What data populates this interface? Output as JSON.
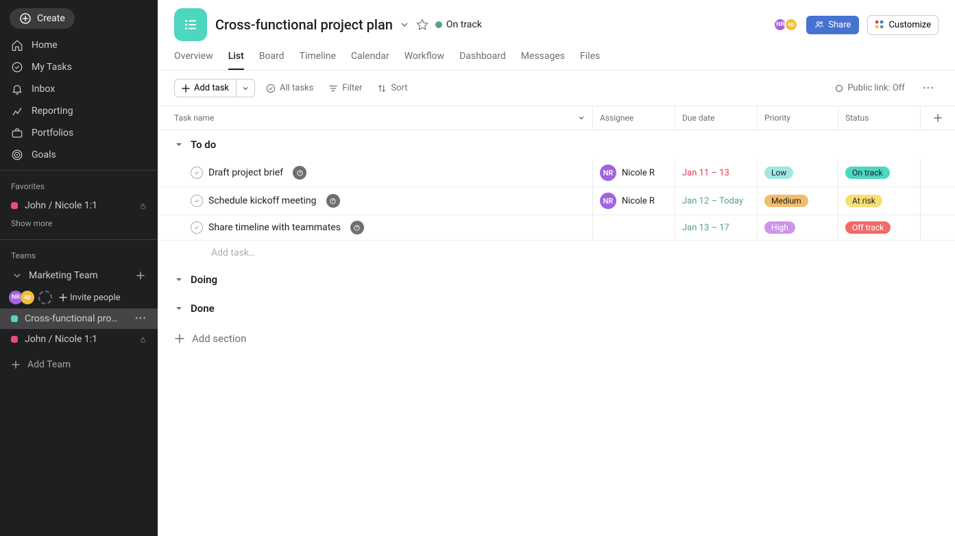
{
  "sidebar": {
    "create": "Create",
    "nav": [
      {
        "label": "Home",
        "icon": "home"
      },
      {
        "label": "My Tasks",
        "icon": "check-circle"
      },
      {
        "label": "Inbox",
        "icon": "bell"
      },
      {
        "label": "Reporting",
        "icon": "chart"
      },
      {
        "label": "Portfolios",
        "icon": "briefcase"
      },
      {
        "label": "Goals",
        "icon": "target"
      }
    ],
    "favorites_heading": "Favorites",
    "favorites": [
      {
        "label": "John / Nicole 1:1",
        "color": "#e84e78",
        "locked": true
      }
    ],
    "show_more": "Show more",
    "teams_heading": "Teams",
    "team": {
      "name": "Marketing Team",
      "avatars": [
        {
          "initials": "NR",
          "color": "#a362e0"
        },
        {
          "initials": "ap",
          "color": "#f1bd3a"
        }
      ],
      "invite": "Invite people",
      "projects": [
        {
          "label": "Cross-functional pro…",
          "color": "#4dd6c0",
          "active": true,
          "locked": false
        },
        {
          "label": "John / Nicole 1:1",
          "color": "#e84e78",
          "active": false,
          "locked": true
        }
      ]
    },
    "add_team": "Add Team"
  },
  "header": {
    "title": "Cross-functional project plan",
    "status": "On track",
    "avatars": [
      {
        "initials": "NR",
        "color": "#a362e0"
      },
      {
        "initials": "ap",
        "color": "#f1bd3a"
      }
    ],
    "share": "Share",
    "customize": "Customize"
  },
  "tabs": [
    "Overview",
    "List",
    "Board",
    "Timeline",
    "Calendar",
    "Workflow",
    "Dashboard",
    "Messages",
    "Files"
  ],
  "active_tab": "List",
  "toolbar": {
    "add_task": "Add task",
    "all_tasks": "All tasks",
    "filter": "Filter",
    "sort": "Sort",
    "public_link": "Public link: Off"
  },
  "columns": {
    "task": "Task name",
    "assignee": "Assignee",
    "due": "Due date",
    "priority": "Priority",
    "status": "Status"
  },
  "sections": [
    {
      "name": "To do",
      "expanded": true,
      "tasks": [
        {
          "name": "Draft project brief",
          "milestone": true,
          "assignee": {
            "initials": "NR",
            "name": "Nicole R",
            "color": "#a362e0"
          },
          "due": "Jan 11 – 13",
          "due_class": "due-red",
          "priority": {
            "label": "Low",
            "bg": "#9ee7e3",
            "fg": "#1e1f21"
          },
          "status": {
            "label": "On track",
            "bg": "#4dd6c0",
            "fg": "#1e1f21"
          }
        },
        {
          "name": "Schedule kickoff meeting",
          "milestone": true,
          "assignee": {
            "initials": "NR",
            "name": "Nicole R",
            "color": "#a362e0"
          },
          "due": "Jan 12 – Today",
          "due_class": "due-green",
          "priority": {
            "label": "Medium",
            "bg": "#f1bd6c",
            "fg": "#1e1f21"
          },
          "status": {
            "label": "At risk",
            "bg": "#f8df72",
            "fg": "#1e1f21"
          }
        },
        {
          "name": "Share timeline with teammates",
          "milestone": true,
          "assignee": null,
          "due": "Jan 13 – 17",
          "due_class": "due-green",
          "priority": {
            "label": "High",
            "bg": "#cd95ea",
            "fg": "#fff"
          },
          "status": {
            "label": "Off track",
            "bg": "#f06a6a",
            "fg": "#fff"
          }
        }
      ],
      "add_task": "Add task…"
    },
    {
      "name": "Doing",
      "expanded": false,
      "tasks": []
    },
    {
      "name": "Done",
      "expanded": false,
      "tasks": []
    }
  ],
  "add_section": "Add section"
}
